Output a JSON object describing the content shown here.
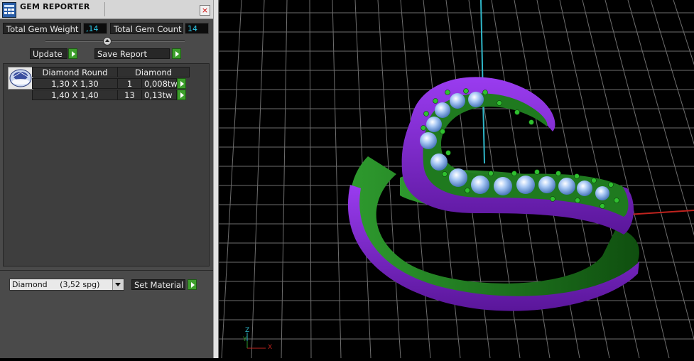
{
  "window": {
    "title": "GEM REPORTER",
    "close_symbol": "×"
  },
  "summary": {
    "total_weight_label": "Total Gem Weight",
    "total_weight_value": ",14",
    "total_count_label": "Total Gem Count",
    "total_count_value": "14"
  },
  "actions": {
    "update_label": "Update",
    "save_report_label": "Save Report"
  },
  "table": {
    "headers": [
      "Diamond Round",
      "Diamond"
    ],
    "rows": [
      {
        "size": "1,30 X 1,30",
        "count": "1",
        "weight": "0,008tw"
      },
      {
        "size": "1,40 X 1,40",
        "count": "13",
        "weight": "0,13tw"
      }
    ]
  },
  "material": {
    "selected": "Diamond     (3,52 spg)",
    "set_label": "Set Material"
  },
  "viewport": {
    "axis_labels": {
      "x": "X",
      "y": "Y",
      "z": "Z"
    },
    "colors": {
      "band_outer": "#7a22c8",
      "band_inner": "#1f7a1f",
      "gem": "#8fbaf2",
      "grid": "#6e6e6e",
      "background": "#000000"
    }
  },
  "icons": [
    "gem-reporter-app-icon",
    "close-icon",
    "slider-knob",
    "play-arrow-icon",
    "round-diamond-thumbnail",
    "dropdown-arrow-icon",
    "axis-triad"
  ]
}
